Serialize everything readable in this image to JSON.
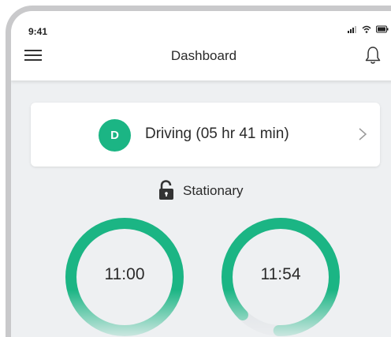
{
  "status_bar": {
    "time": "9:41"
  },
  "header": {
    "title": "Dashboard"
  },
  "duty_status": {
    "avatar_letter": "D",
    "label": "Driving (05 hr 41 min)"
  },
  "vehicle": {
    "state_label": "Stationary"
  },
  "gauges": [
    {
      "value": "11:00",
      "progress": 1.0
    },
    {
      "value": "11:54",
      "progress": 0.88
    }
  ],
  "colors": {
    "accent": "#1bb584",
    "track": "#dcdfe3",
    "background": "#eef0f2"
  },
  "icons": [
    "signal-icon",
    "wifi-icon",
    "battery-icon",
    "menu-icon",
    "bell-icon",
    "chevron-right-icon",
    "lock-open-icon"
  ]
}
